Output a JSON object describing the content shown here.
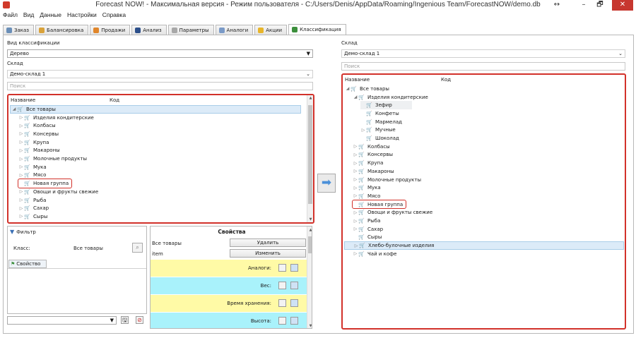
{
  "window": {
    "title": "Forecast NOW! - Максимальная версия - Режим пользователя - C:/Users/Denis/AppData/Roaming/Ingenious Team/ForecastNOW/demo.db",
    "controls": {
      "extra": "↔",
      "minimize": "–",
      "maximize": "🗗",
      "close": "✕"
    }
  },
  "menu": [
    "Файл",
    "Вид",
    "Данные",
    "Настройки",
    "Справка"
  ],
  "tabs": [
    {
      "label": "Заказ",
      "icon": "order-icon",
      "color": "#6b8fb8"
    },
    {
      "label": "Балансировка",
      "icon": "balance-icon",
      "color": "#d9a23a"
    },
    {
      "label": "Продажи",
      "icon": "sales-icon",
      "color": "#e0862b"
    },
    {
      "label": "Анализ",
      "icon": "analysis-icon",
      "color": "#2c4f8a"
    },
    {
      "label": "Параметры",
      "icon": "params-icon",
      "color": "#a8a8a8"
    },
    {
      "label": "Аналоги",
      "icon": "analogs-icon",
      "color": "#7a9ac7"
    },
    {
      "label": "Акции",
      "icon": "promo-icon",
      "color": "#e8b52a"
    },
    {
      "label": "Классификация",
      "icon": "classification-icon",
      "color": "#3c8f3c"
    }
  ],
  "left": {
    "classification_label": "Вид классификации",
    "classification_value": "Дерево",
    "warehouse_label": "Склад",
    "warehouse_value": "Демо-склад 1",
    "search_placeholder": "Поиск",
    "tree_header": {
      "name": "Название",
      "code": "Код"
    },
    "tree_items": [
      {
        "label": "Все товары",
        "level": 0,
        "expand": "◢",
        "selected": true
      },
      {
        "label": "Изделия кондитерские",
        "level": 1,
        "expand": "▷"
      },
      {
        "label": "Колбасы",
        "level": 1,
        "expand": "▷"
      },
      {
        "label": "Консервы",
        "level": 1,
        "expand": "▷"
      },
      {
        "label": "Крупа",
        "level": 1,
        "expand": "▷"
      },
      {
        "label": "Макароны",
        "level": 1,
        "expand": "▷"
      },
      {
        "label": "Молочные продукты",
        "level": 1,
        "expand": "▷"
      },
      {
        "label": "Мука",
        "level": 1,
        "expand": "▷"
      },
      {
        "label": "Мясо",
        "level": 1,
        "expand": "▷"
      },
      {
        "label": "Новая группа",
        "level": 1,
        "expand": "",
        "boxed": true
      },
      {
        "label": "Овощи и фрукты свежие",
        "level": 1,
        "expand": "▷"
      },
      {
        "label": "Рыба",
        "level": 1,
        "expand": "▷"
      },
      {
        "label": "Сахар",
        "level": 1,
        "expand": "▷"
      },
      {
        "label": "Сыры",
        "level": 1,
        "expand": "▷"
      }
    ]
  },
  "filter": {
    "title": "Фильтр",
    "class_label": "Класс:",
    "class_value": "Все товары",
    "property_tab": "Свойство"
  },
  "properties": {
    "title": "Свойства",
    "rows": [
      {
        "name": "Все товары",
        "button": "Удалить"
      },
      {
        "name": "item",
        "button": "Изменить"
      }
    ],
    "fields": [
      {
        "label": "Аналоги:",
        "color": "#fffaa6"
      },
      {
        "label": "Вес:",
        "color": "#a9f2fb"
      },
      {
        "label": "Время хранения:",
        "color": "#fffaa6"
      },
      {
        "label": "Высота:",
        "color": "#a9f2fb"
      }
    ]
  },
  "transfer_arrow": "➡",
  "right": {
    "warehouse_label": "Склад",
    "warehouse_value": "Демо-склад 1",
    "search_placeholder": "Поиск",
    "tree_header": {
      "name": "Название",
      "code": "Код"
    },
    "tree_items": [
      {
        "label": "Все товары",
        "level": 0,
        "expand": "◢"
      },
      {
        "label": "Изделия кондитерские",
        "level": 1,
        "expand": "◢"
      },
      {
        "label": "Зефир",
        "level": 2,
        "expand": "",
        "hover": true
      },
      {
        "label": "Конфеты",
        "level": 2,
        "expand": ""
      },
      {
        "label": "Мармелад",
        "level": 2,
        "expand": ""
      },
      {
        "label": "Мучные",
        "level": 2,
        "expand": "▷"
      },
      {
        "label": "Шоколад",
        "level": 2,
        "expand": ""
      },
      {
        "label": "Колбасы",
        "level": 1,
        "expand": "▷"
      },
      {
        "label": "Консервы",
        "level": 1,
        "expand": "▷"
      },
      {
        "label": "Крупа",
        "level": 1,
        "expand": "▷"
      },
      {
        "label": "Макароны",
        "level": 1,
        "expand": "▷"
      },
      {
        "label": "Молочные продукты",
        "level": 1,
        "expand": "▷"
      },
      {
        "label": "Мука",
        "level": 1,
        "expand": "▷"
      },
      {
        "label": "Мясо",
        "level": 1,
        "expand": "▷"
      },
      {
        "label": "Новая группа",
        "level": 1,
        "expand": "",
        "boxed": true
      },
      {
        "label": "Овощи и фрукты свежие",
        "level": 1,
        "expand": "▷"
      },
      {
        "label": "Рыба",
        "level": 1,
        "expand": "▷"
      },
      {
        "label": "Сахар",
        "level": 1,
        "expand": "▷"
      },
      {
        "label": "Сыры",
        "level": 1,
        "expand": ""
      },
      {
        "label": "Хлебо-булочные изделия",
        "level": 1,
        "expand": "▷",
        "selected": true
      },
      {
        "label": "Чай и кофе",
        "level": 1,
        "expand": "▷"
      }
    ]
  },
  "colors": {
    "highlight_border": "#d2312a",
    "selection": "#dcebf8",
    "arrow_button": "#4a90d9"
  }
}
